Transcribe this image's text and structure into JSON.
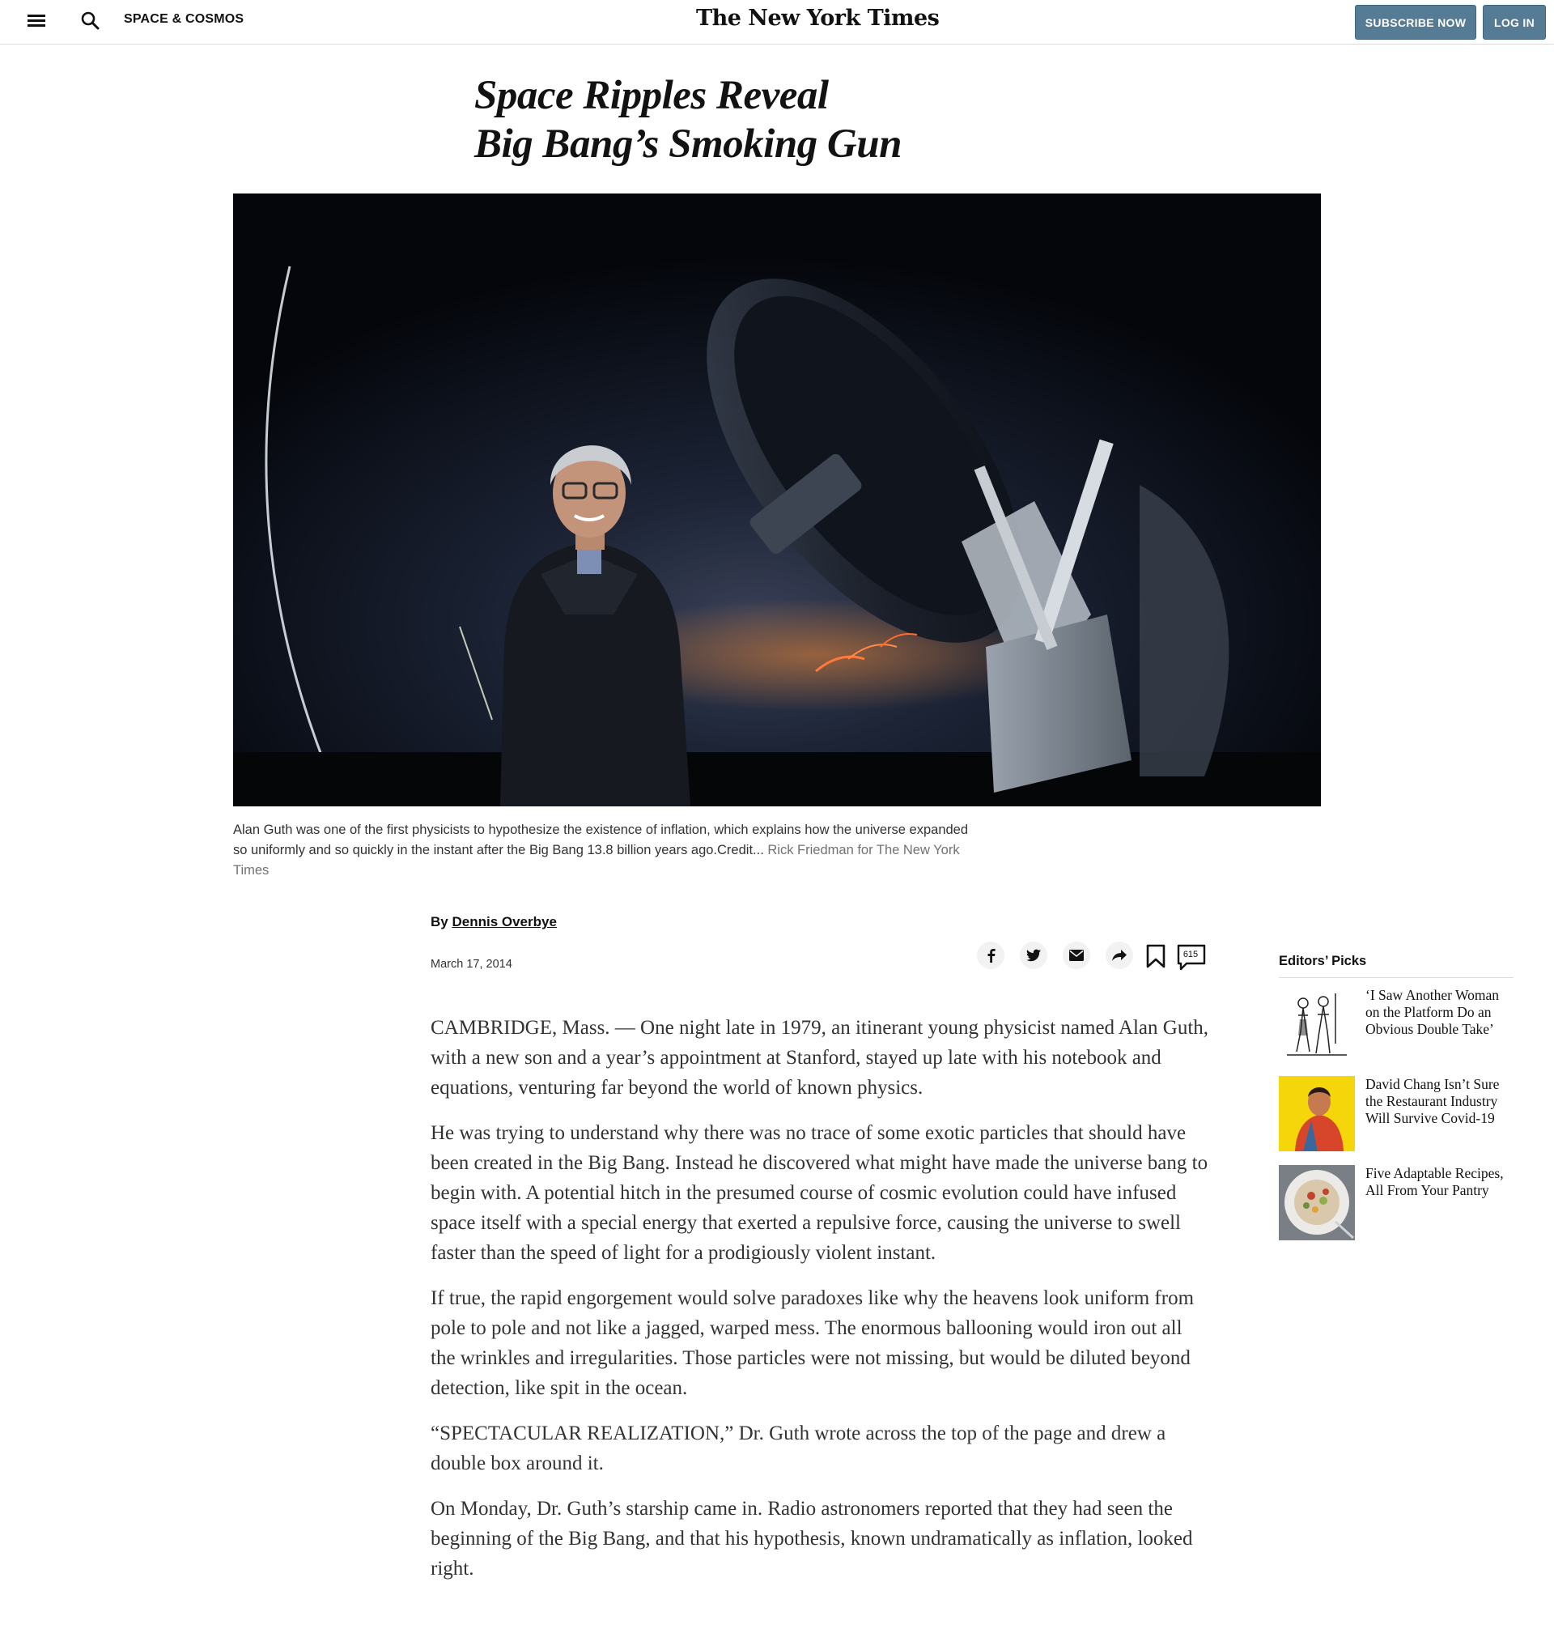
{
  "header": {
    "section": "SPACE & COSMOS",
    "logo": "The New York Times",
    "subscribe_label": "SUBSCRIBE NOW",
    "login_label": "LOG IN"
  },
  "article": {
    "headline_line1": "Space Ripples Reveal",
    "headline_line2": "Big Bang’s Smoking Gun",
    "caption_text": "Alan Guth was one of the first physicists to hypothesize the existence of inflation, which explains how the universe expanded so uniformly and so quickly in the instant after the Big Bang 13.8 billion years ago.",
    "caption_credit_label": "Credit...",
    "caption_credit": "Rick Friedman for The New York Times",
    "byline_prefix": "By",
    "author": "Dennis Overbye",
    "date": "March 17, 2014",
    "comment_count": "615",
    "paragraphs": [
      "CAMBRIDGE, Mass. — One night late in 1979, an itinerant young physicist named Alan Guth, with a new son and a year’s appointment at Stanford, stayed up late with his notebook and equations, venturing far beyond the world of known physics.",
      "He was trying to understand why there was no trace of some exotic particles that should have been created in the Big Bang. Instead he discovered what might have made the universe bang to begin with. A potential hitch in the presumed course of cosmic evolution could have infused space itself with a special energy that exerted a repulsive force, causing the universe to swell faster than the speed of light for a prodigiously violent instant.",
      "If true, the rapid engorgement would solve paradoxes like why the heavens look uniform from pole to pole and not like a jagged, warped mess. The enormous ballooning would iron out all the wrinkles and irregularities. Those particles were not missing, but would be diluted beyond detection, like spit in the ocean.",
      "“SPECTACULAR REALIZATION,” Dr. Guth wrote across the top of the page and drew a double box around it.",
      "On Monday, Dr. Guth’s starship came in. Radio astronomers reported that they had seen the beginning of the Big Bang, and that his hypothesis, known undramatically as inflation, looked right."
    ]
  },
  "share": {
    "icons": [
      "facebook-icon",
      "twitter-icon",
      "email-icon",
      "share-icon",
      "bookmark-icon",
      "comments-icon"
    ]
  },
  "editors_picks": {
    "title": "Editors’ Picks",
    "items": [
      {
        "title": "‘I Saw Another Woman on the Platform Do an Obvious Double Take’"
      },
      {
        "title": "David Chang Isn’t Sure the Restaurant Industry Will Survive Covid-19"
      },
      {
        "title": "Five Adaptable Recipes, All From Your Pantry"
      }
    ]
  },
  "colors": {
    "button_blue": "#567b95",
    "text": "#121212",
    "body_text": "#333333"
  }
}
